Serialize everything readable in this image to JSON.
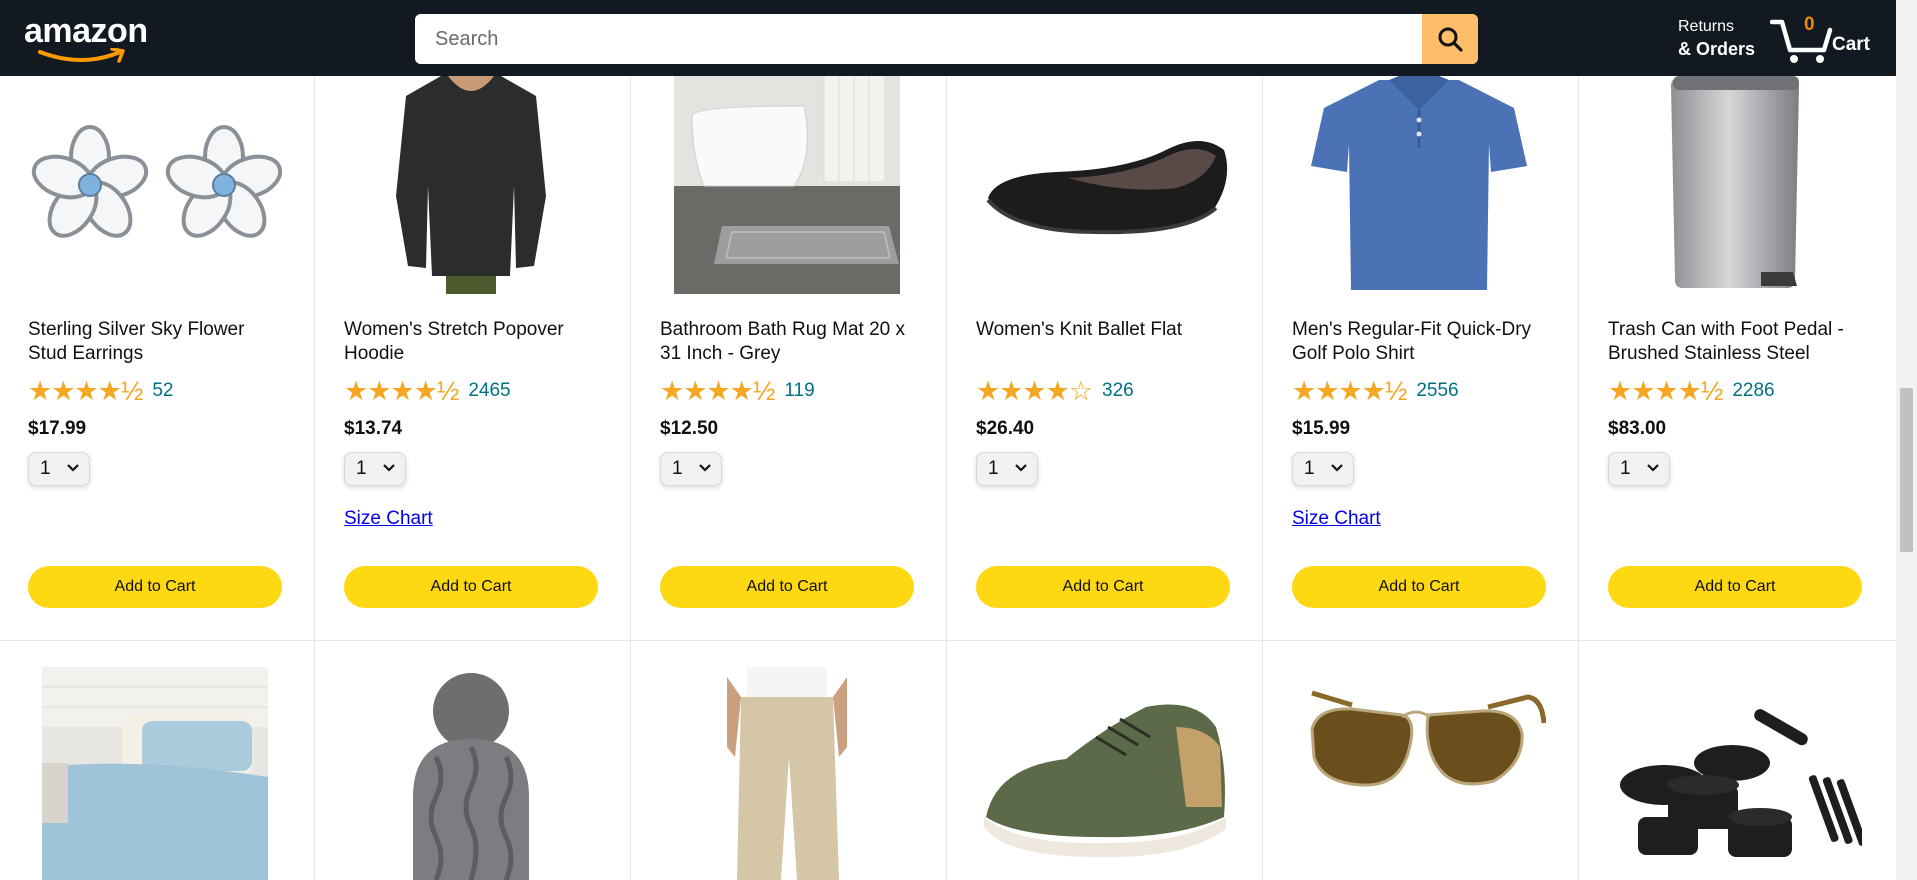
{
  "header": {
    "logo": "amazon",
    "search_placeholder": "Search",
    "search_icon": "search-icon",
    "returns_line1": "Returns",
    "returns_line2": "& Orders",
    "cart_count": "0",
    "cart_label": "Cart",
    "cart_icon": "cart-icon"
  },
  "products": [
    {
      "title": "Sterling Silver Sky Flower Stud Earrings",
      "stars": "★★★★½",
      "rating": 4.5,
      "review_count": "52",
      "price": "$17.99",
      "qty": "1",
      "size_chart": "",
      "add_to_cart": "Add to Cart",
      "image": "flower-earrings-image"
    },
    {
      "title": "Women's Stretch Popover Hoodie",
      "stars": "★★★★½",
      "rating": 4.5,
      "review_count": "2465",
      "price": "$13.74",
      "qty": "1",
      "size_chart": "Size Chart",
      "add_to_cart": "Add to Cart",
      "image": "black-hoodie-image"
    },
    {
      "title": "Bathroom Bath Rug Mat 20 x 31 Inch - Grey",
      "stars": "★★★★½",
      "rating": 4.5,
      "review_count": "119",
      "price": "$12.50",
      "qty": "1",
      "size_chart": "",
      "add_to_cart": "Add to Cart",
      "image": "bath-rug-image"
    },
    {
      "title": "Women's Knit Ballet Flat",
      "stars": "★★★★☆",
      "rating": 4.0,
      "review_count": "326",
      "price": "$26.40",
      "qty": "1",
      "size_chart": "",
      "add_to_cart": "Add to Cart",
      "image": "ballet-flat-image"
    },
    {
      "title": "Men's Regular-Fit Quick-Dry Golf Polo Shirt",
      "stars": "★★★★½",
      "rating": 4.5,
      "review_count": "2556",
      "price": "$15.99",
      "qty": "1",
      "size_chart": "Size Chart",
      "add_to_cart": "Add to Cart",
      "image": "polo-shirt-image"
    },
    {
      "title": "Trash Can with Foot Pedal - Brushed Stainless Steel",
      "stars": "★★★★½",
      "rating": 4.5,
      "review_count": "2286",
      "price": "$83.00",
      "qty": "1",
      "size_chart": "",
      "add_to_cart": "Add to Cart",
      "image": "trash-can-image"
    }
  ],
  "row2_images": [
    "bedding-image",
    "knit-beanie-image",
    "khaki-pants-image",
    "sneaker-image",
    "aviator-sunglasses-image",
    "cookware-set-image"
  ],
  "colors": {
    "header_bg": "#131921",
    "search_button": "#febd69",
    "add_button": "#ffd814",
    "star": "#f5a623",
    "link": "#007185",
    "cart_count": "#f08804"
  }
}
